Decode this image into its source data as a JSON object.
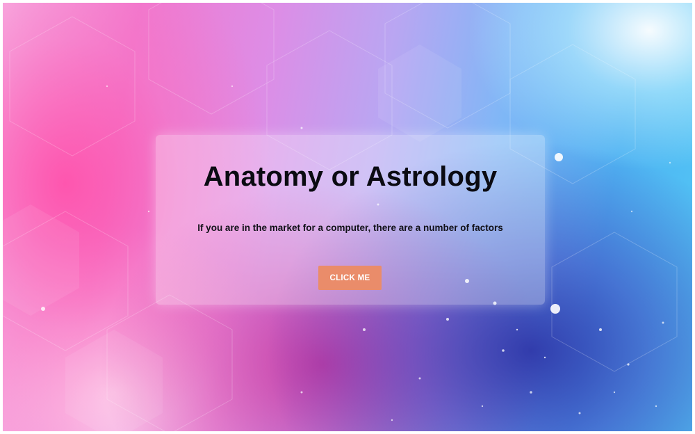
{
  "hero": {
    "title": "Anatomy or Astrology",
    "subtitle": "If you are in the market for a computer, there are a number of factors",
    "button_label": "CLICK ME"
  },
  "colors": {
    "button": "#ea8c6a",
    "title_text": "#0b0b12",
    "button_text": "#ffffff"
  }
}
